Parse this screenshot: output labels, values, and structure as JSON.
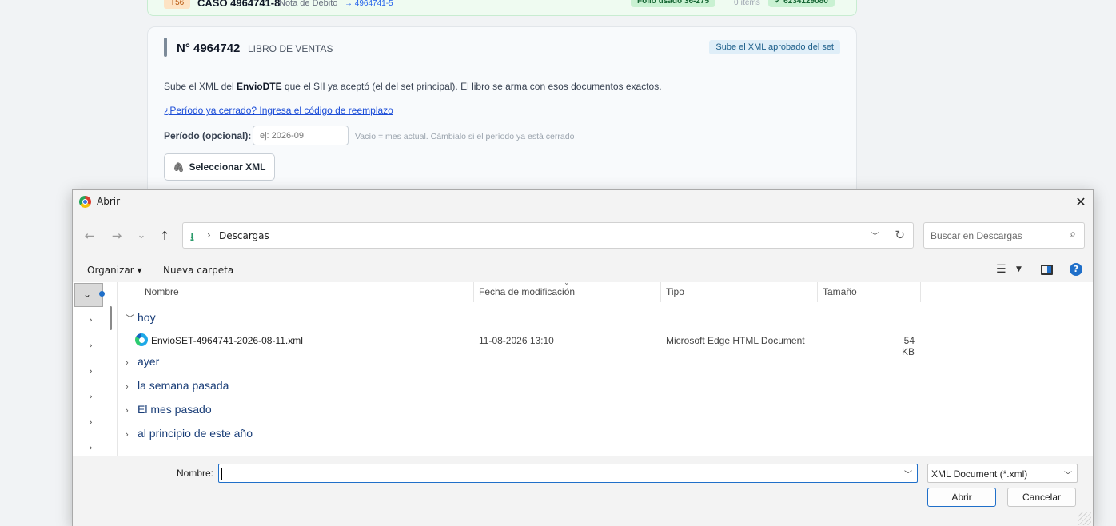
{
  "prev_case": {
    "tag": "T56",
    "title": "CASO 4964741-8",
    "type": "Nota de Débito",
    "link": "→ 4964741-5",
    "folio": "Folio usado 36-275",
    "items": "0 ítems",
    "amount": "✓ 6234129080"
  },
  "card": {
    "number": "N° 4964742",
    "section": "LIBRO DE VENTAS",
    "badge": "Sube el XML aprobado del set",
    "desc_pre": "Sube el XML del ",
    "desc_bold": "EnvioDTE",
    "desc_post": " que el SII ya aceptó (el del set principal). El libro se arma con esos documentos exactos.",
    "link": "¿Período ya cerrado? Ingresa el código de reemplazo",
    "period_label": "Período (opcional):",
    "period_placeholder": "ej: 2026-09",
    "period_hint": "Vacío = mes actual. Cámbialo si el período ya está cerrado",
    "select_button": "Seleccionar XML",
    "select_icon": "paperclip-icon"
  },
  "dialog": {
    "title": "Abrir",
    "close_glyph": "✕",
    "nav": {
      "back": "←",
      "forward": "→",
      "recent": "⌄",
      "up": "↑"
    },
    "address": {
      "icon": "download-icon",
      "separator": "›",
      "location": "Descargas"
    },
    "search_placeholder": "Buscar en Descargas",
    "toolbar": {
      "organize": "Organizar ▾",
      "new_folder": "Nueva carpeta",
      "view_icon": "list-view-icon",
      "help": "?"
    },
    "columns": [
      "Nombre",
      "Fecha de modificación",
      "Tipo",
      "Tamaño"
    ],
    "groups": [
      {
        "label": "hoy",
        "expanded": true
      },
      {
        "label": "ayer",
        "expanded": false
      },
      {
        "label": "la semana pasada",
        "expanded": false
      },
      {
        "label": "El mes pasado",
        "expanded": false
      },
      {
        "label": "al principio de este año",
        "expanded": false
      }
    ],
    "file": {
      "name": "EnvioSET-4964741-2026-08-11.xml",
      "date": "11-08-2026 13:10",
      "type": "Microsoft Edge HTML Document",
      "size": "54 KB",
      "icon": "edge-icon"
    },
    "filename_label": "Nombre:",
    "filename_value": "",
    "filter": "XML Document (*.xml)",
    "open_button": "Abrir",
    "cancel_button": "Cancelar"
  }
}
